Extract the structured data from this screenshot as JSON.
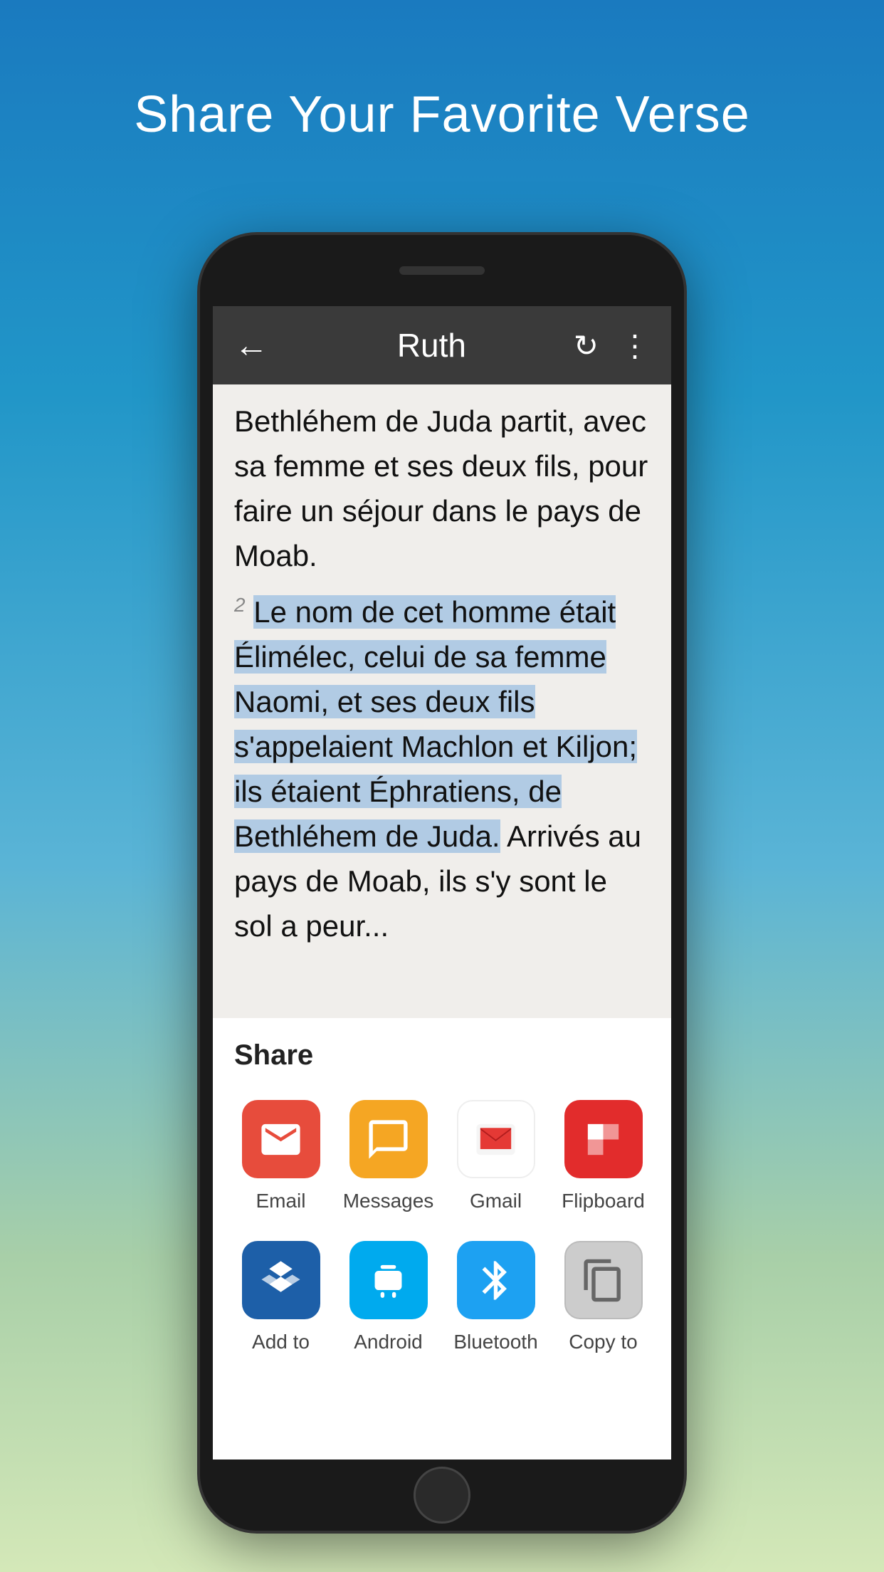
{
  "page": {
    "title": "Share Your Favorite Verse",
    "background_gradient_start": "#1a7abf",
    "background_gradient_end": "#d4e8b8"
  },
  "toolbar": {
    "back_label": "←",
    "title": "Ruth",
    "refresh_label": "↻",
    "more_label": "⋮"
  },
  "bible_text": {
    "partial_verse_top": "Bethléhem de Juda partit, avec sa femme et ses deux fils, pour faire un séjour dans le pays de Moab.",
    "verse2_number": "2",
    "verse2_text_highlighted": "Le nom de cet homme était Élimélec, celui de sa femme Naomi, et ses deux fils s'appelaient Machlon et Kiljon; ils étaient Éphratiens, de Bethléhem de Juda.",
    "verse2_text_normal": " Arrivés au pays de Moab, ils s'y sont le sol a peur..."
  },
  "share_sheet": {
    "title": "Share",
    "row1": [
      {
        "id": "email",
        "label": "Email",
        "icon_type": "email",
        "color": "#e74c3c"
      },
      {
        "id": "messages",
        "label": "Messages",
        "icon_type": "messages",
        "color": "#f5a623"
      },
      {
        "id": "gmail",
        "label": "Gmail",
        "icon_type": "gmail",
        "color": "#ffffff"
      },
      {
        "id": "flipboard",
        "label": "Flipboard",
        "icon_type": "flipboard",
        "color": "#e22c2c"
      }
    ],
    "row2": [
      {
        "id": "dropbox",
        "label": "Add to",
        "icon_type": "dropbox",
        "color": "#1d5fa8"
      },
      {
        "id": "android",
        "label": "Android",
        "icon_type": "android",
        "color": "#00aaee"
      },
      {
        "id": "bluetooth",
        "label": "Bluetooth",
        "icon_type": "bluetooth",
        "color": "#1da1f2"
      },
      {
        "id": "copy",
        "label": "Copy to",
        "icon_type": "copy",
        "color": "#cccccc"
      }
    ]
  }
}
